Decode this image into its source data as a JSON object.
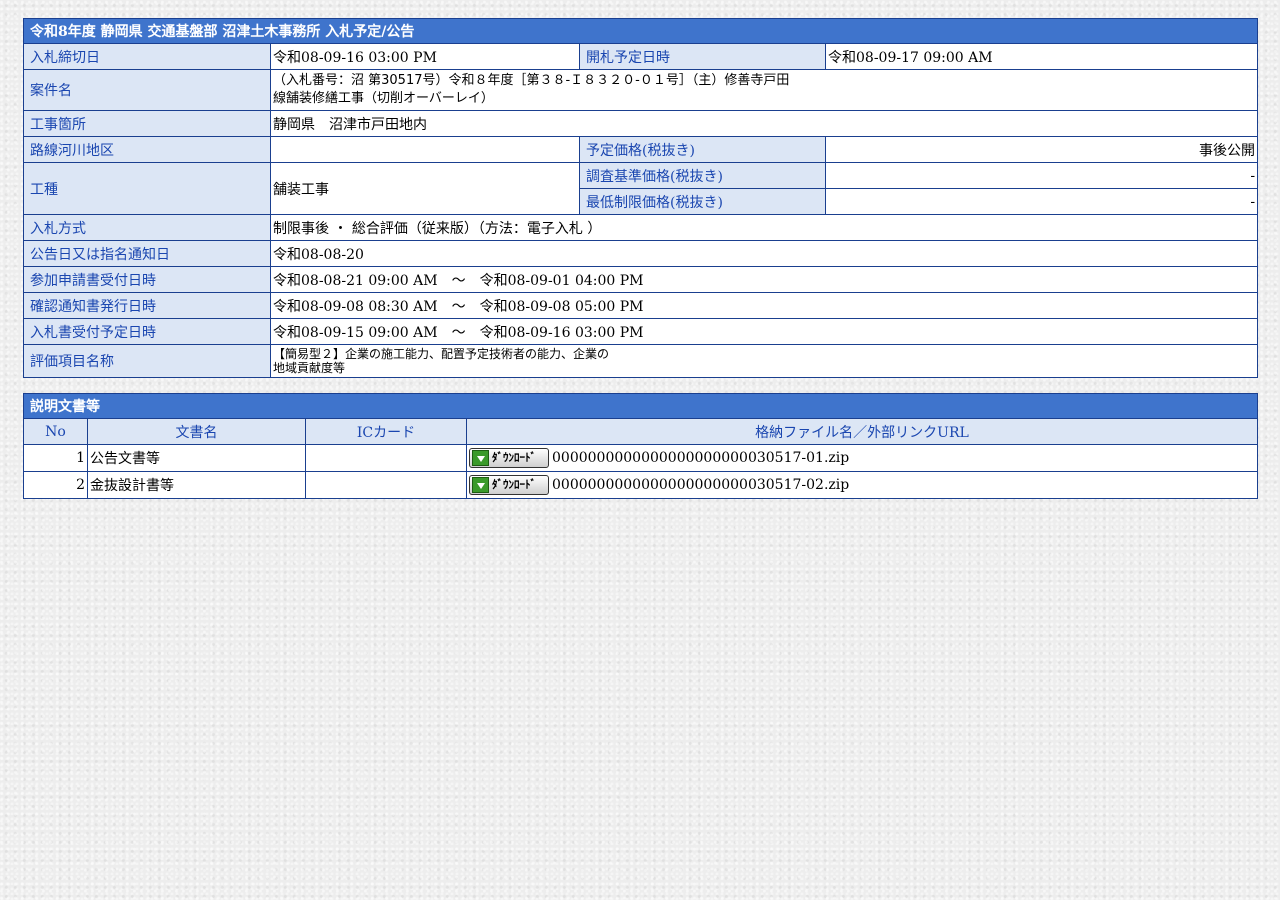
{
  "notice": {
    "title": "令和8年度 静岡県 交通基盤部 沼津土木事務所 入札予定/公告",
    "rows": {
      "deadline_label": "入札締切日",
      "deadline_value": "令和08-09-16 03:00 PM",
      "opening_label": "開札予定日時",
      "opening_value": "令和08-09-17 09:00 AM",
      "case_label": "案件名",
      "case_value_line1": "（入札番号：沼 第30517号）令和８年度［第３８-Ｉ８３２０-０１号］（主）修善寺戸田",
      "case_value_line2": "線舗装修繕工事（切削オーバーレイ）",
      "site_label": "工事箇所",
      "site_value": "静岡県　沼津市戸田地内",
      "route_label": "路線河川地区",
      "route_value": "",
      "planned_price_label": "予定価格(税抜き)",
      "planned_price_value": "事後公開",
      "type_label": "工種",
      "type_value": "舗装工事",
      "survey_price_label": "調査基準価格(税抜き)",
      "survey_price_value": "-",
      "min_price_label": "最低制限価格(税抜き)",
      "min_price_value": "-",
      "method_label": "入札方式",
      "method_value": "制限事後 ・ 総合評価（従来版）（方法：電子入札 ）",
      "announce_label": "公告日又は指名通知日",
      "announce_value": "令和08-08-20",
      "apply_label": "参加申請書受付日時",
      "apply_value": "令和08-08-21 09:00 AM　～　令和08-09-01 04:00 PM",
      "confirm_label": "確認通知書発行日時",
      "confirm_value": "令和08-09-08 08:30 AM　～　令和08-09-08 05:00 PM",
      "receipt_label": "入札書受付予定日時",
      "receipt_value": "令和08-09-15 09:00 AM　～　令和08-09-16 03:00 PM",
      "eval_label": "評価項目名称",
      "eval_value_line1": "【簡易型２】企業の施工能力、配置予定技術者の能力、企業の",
      "eval_value_line2": "地域貢献度等"
    }
  },
  "documents": {
    "title": "説明文書等",
    "columns": [
      "No",
      "文書名",
      "ICカード",
      "格納ファイル名／外部リンクURL"
    ],
    "download_label": "ﾀﾞｳﾝﾛｰﾄﾞ",
    "items": [
      {
        "no": "1",
        "name": "公告文書等",
        "ic": "",
        "file": "0000000000000000000000030517-01.zip"
      },
      {
        "no": "2",
        "name": "金抜設計書等",
        "ic": "",
        "file": "0000000000000000000000030517-02.zip"
      }
    ]
  }
}
